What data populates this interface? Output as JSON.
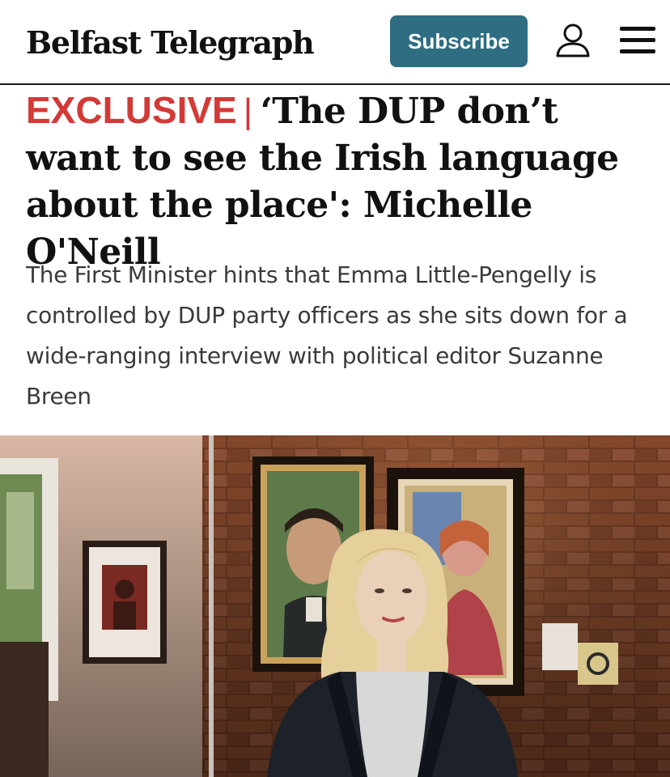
{
  "header": {
    "logo": "Belfast Telegraph",
    "subscribe_label": "Subscribe",
    "icons": {
      "account": "user-icon",
      "menu": "hamburger-menu-icon"
    },
    "brand_color": "#2f6e82"
  },
  "article": {
    "kicker": "EXCLUSIVE",
    "kicker_separator": "|",
    "kicker_color": "#d23a36",
    "headline": "‘The DUP don’t want to see the Irish language about the place': Michelle O'Neill",
    "standfirst": "The First Minister hints that Emma Little-Pengelly is controlled by DUP party officers as she sits down for a wide-ranging interview with political editor Suzanne Breen"
  }
}
